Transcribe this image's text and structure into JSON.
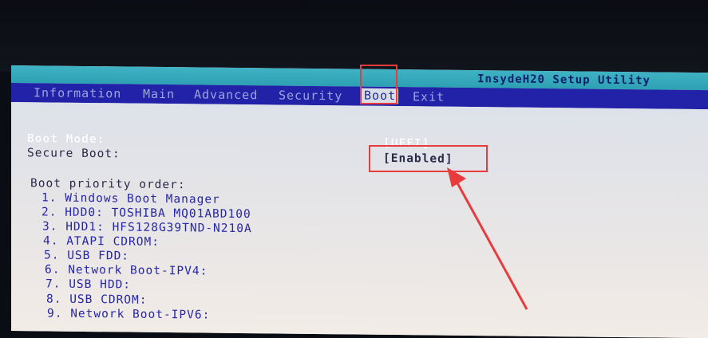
{
  "window": {
    "title": "InsydeH20 Setup Utility"
  },
  "menu": [
    {
      "label": "Information",
      "active": false
    },
    {
      "label": "Main",
      "active": false
    },
    {
      "label": "Advanced",
      "active": false
    },
    {
      "label": "Security",
      "active": false
    },
    {
      "label": "Boot",
      "active": true
    },
    {
      "label": "Exit",
      "active": false
    }
  ],
  "settings": {
    "boot_mode": {
      "label": "Boot Mode:",
      "value": "[UEFI]"
    },
    "secure_boot": {
      "label": "Secure Boot:",
      "value": "[Enabled]"
    }
  },
  "boot_priority": {
    "heading": "Boot priority order:",
    "items": [
      "1. Windows Boot Manager",
      "2. HDD0: TOSHIBA MQ01ABD100",
      "3. HDD1: HFS128G39TND-N210A",
      "4. ATAPI CDROM:",
      "5. USB FDD:",
      "6. Network Boot-IPV4:",
      "7. USB HDD:",
      "8. USB CDROM:",
      "9. Network Boot-IPV6:"
    ]
  },
  "annotation_color": "#e83b3b"
}
